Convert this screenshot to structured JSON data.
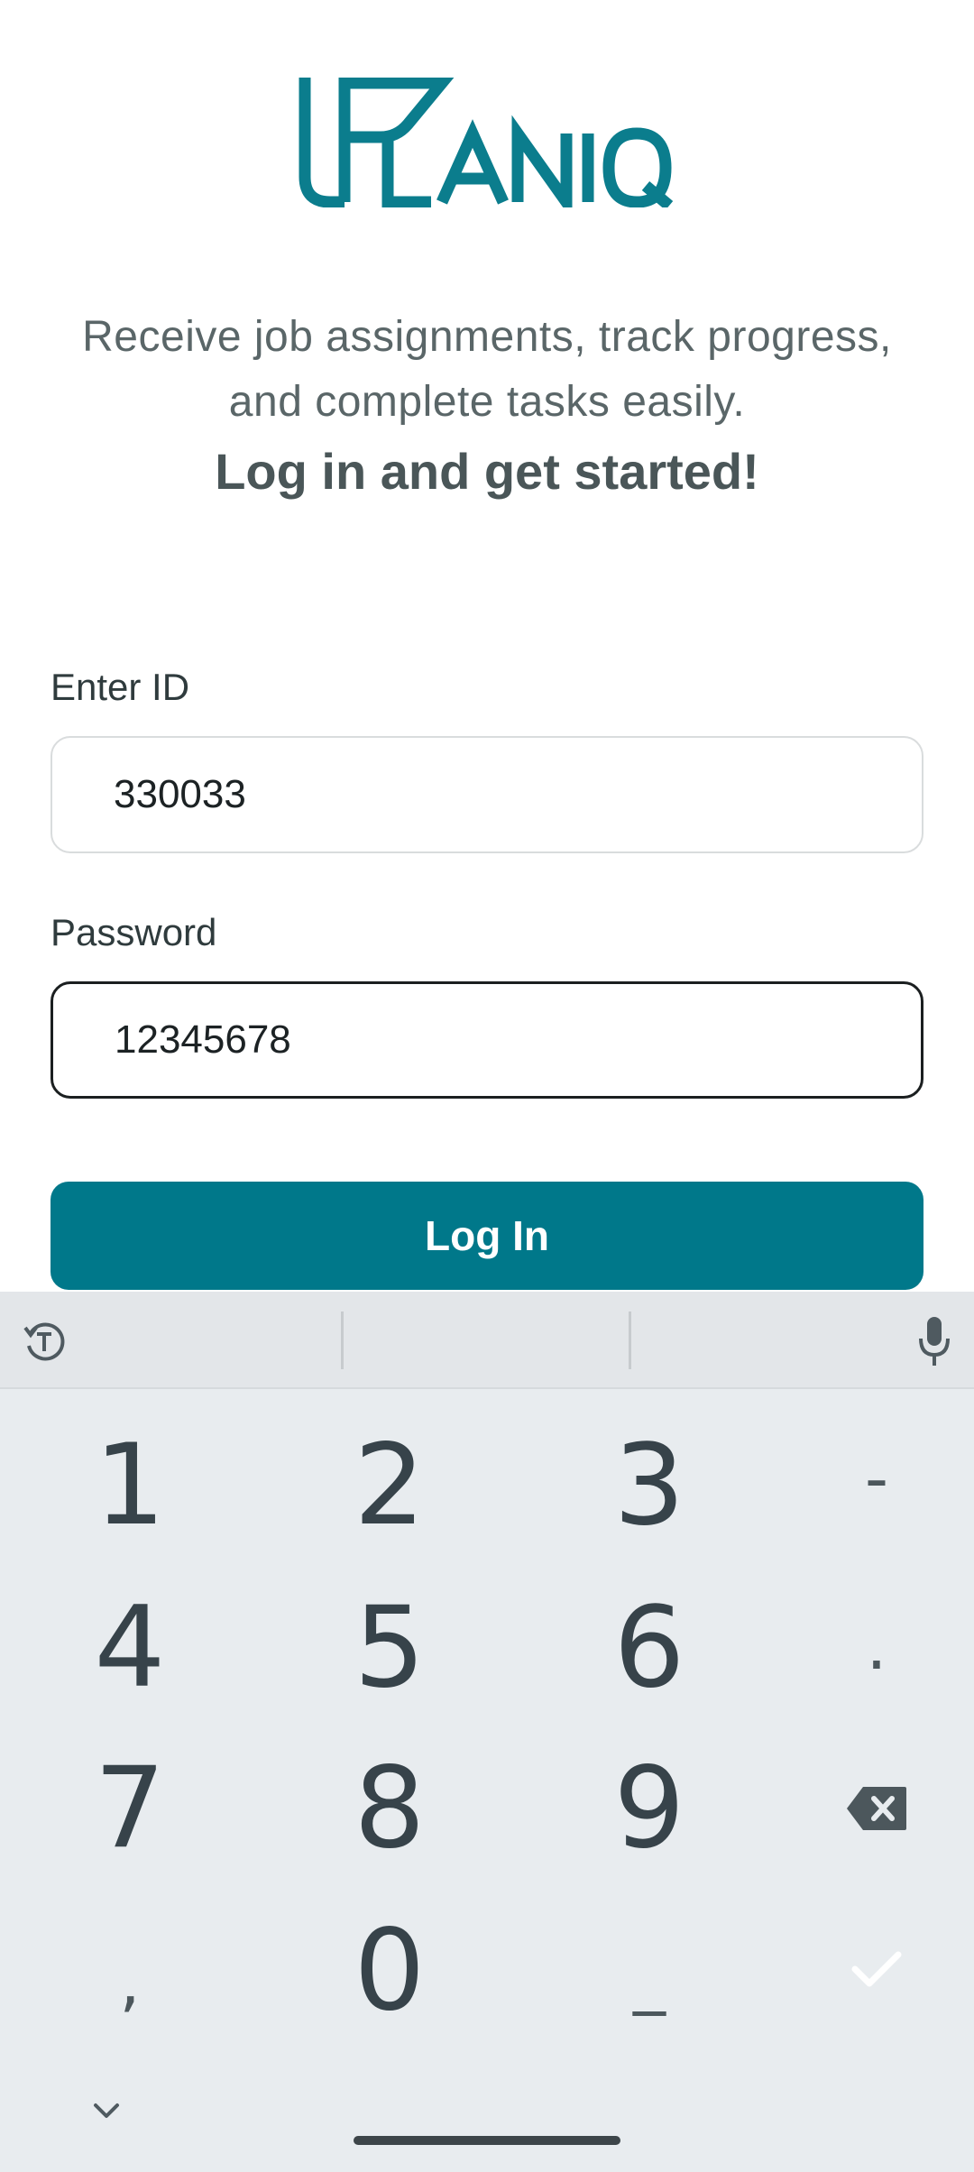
{
  "brand": {
    "logo_text": "PLANIQ",
    "color": "#0b7d8d"
  },
  "intro": {
    "line1": "Receive job assignments, track progress,",
    "line2": "and complete tasks easily.",
    "headline": "Log in and get started!"
  },
  "form": {
    "id_label": "Enter ID",
    "id_value": "330033",
    "password_label": "Password",
    "password_value": "12345678",
    "login_button": "Log In"
  },
  "keyboard": {
    "toolbar": {
      "left_icon": "text-mode-icon",
      "right_icon": "microphone-icon"
    },
    "keys": {
      "k1": "1",
      "k2": "2",
      "k3": "3",
      "minus": "-",
      "k4": "4",
      "k5": "5",
      "k6": "6",
      "dot": ".",
      "k7": "7",
      "k8": "8",
      "k9": "9",
      "comma": ",",
      "k0": "0",
      "underscore": "_"
    },
    "icons": {
      "backspace": "backspace-icon",
      "done": "check-icon",
      "hide": "chevron-down-icon"
    }
  },
  "colors": {
    "primary": "#00788a",
    "keyboard_bg": "#e8ecef",
    "text": "#2f3b3d"
  }
}
